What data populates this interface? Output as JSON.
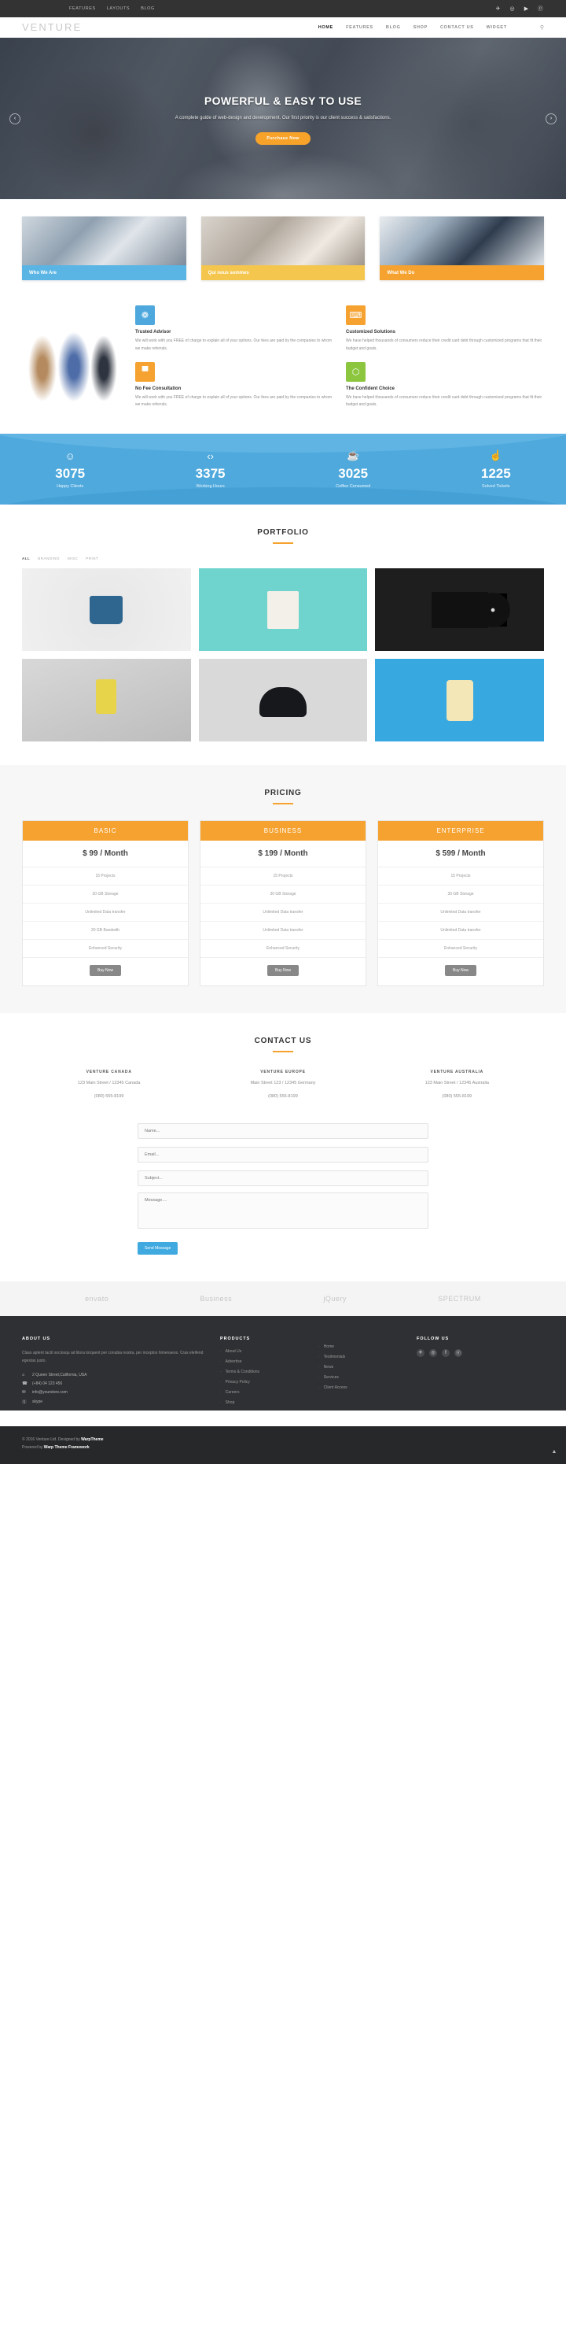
{
  "topbar": {
    "links": [
      "FEATURES",
      "LAYOUTS",
      "BLOG"
    ],
    "socials": [
      "twitter-icon",
      "instagram-icon",
      "youtube-icon",
      "pinterest-icon"
    ],
    "social_glyphs": [
      "✈",
      "◎",
      "▶",
      "ⓟ"
    ]
  },
  "nav": {
    "logo": "VENTURE",
    "items": [
      {
        "label": "HOME",
        "active": true,
        "caret": ""
      },
      {
        "label": "FEATURES",
        "active": false,
        "caret": ""
      },
      {
        "label": "BLOG",
        "active": false,
        "caret": "▾"
      },
      {
        "label": "SHOP",
        "active": false,
        "caret": ""
      },
      {
        "label": "CONTACT US",
        "active": false,
        "caret": ""
      },
      {
        "label": "WIDGET",
        "active": false,
        "caret": ""
      }
    ],
    "search_icon": "⚲"
  },
  "hero": {
    "title": "POWERFUL & EASY TO USE",
    "subtitle": "A complete guide of web-design and development. Our first priority is our client success & satisfactions.",
    "button": "Purchase Now",
    "prev": "‹",
    "next": "›"
  },
  "cards": [
    {
      "caption": "Who We Are",
      "color": "#5ab4e4"
    },
    {
      "caption": "Qui nous sommes",
      "color": "#f4c64e"
    },
    {
      "caption": "What We Do",
      "color": "#f5a230"
    }
  ],
  "features": [
    {
      "icon": "target-icon",
      "glyph": "❁",
      "color": "blue",
      "title": "Trusted Advisor",
      "text": "We will work with you FREE of charge to explain all of your options. Our fees are paid by the companies to whom we make referrals."
    },
    {
      "icon": "chat-icon",
      "glyph": "⌨",
      "color": "orange",
      "title": "Customized Solutions",
      "text": "We have helped thousands of consumers reduce their credit card debt through customized programs that fit their budget and goals."
    },
    {
      "icon": "chart-icon",
      "glyph": "▀",
      "color": "orange2",
      "title": "No Fee Consultation",
      "text": "We will work with you FREE of charge to explain all of your options. Our fees are paid by the companies to whom we make referrals."
    },
    {
      "icon": "shield-icon",
      "glyph": "⬡",
      "color": "green",
      "title": "The Confident Choice",
      "text": "We have helped thousands of consumers reduce their credit card debt through customized programs that fit their budget and goals."
    }
  ],
  "counters": [
    {
      "icon": "smiley-icon",
      "glyph": "☺",
      "value": "3075",
      "label": "Happy Clients"
    },
    {
      "icon": "code-icon",
      "glyph": "‹›",
      "value": "3375",
      "label": "Working Hours"
    },
    {
      "icon": "coffee-icon",
      "glyph": "☕",
      "value": "3025",
      "label": "Coffee Consumed"
    },
    {
      "icon": "thumbs-up-icon",
      "glyph": "☝",
      "value": "1225",
      "label": "Solved Tickets"
    }
  ],
  "portfolio": {
    "title": "PORTFOLIO",
    "filters": [
      {
        "label": "ALL",
        "active": true
      },
      {
        "label": "BRANDING",
        "active": false
      },
      {
        "label": "MISC",
        "active": false
      },
      {
        "label": "PRINT",
        "active": false
      }
    ],
    "items": [
      {
        "name": "enamel-mug"
      },
      {
        "name": "tote-bag"
      },
      {
        "name": "vinyl-record"
      },
      {
        "name": "coffee-cup"
      },
      {
        "name": "snapback-cap"
      },
      {
        "name": "plastic-pouch"
      }
    ]
  },
  "pricing": {
    "title": "PRICING",
    "plans": [
      {
        "name": "BASIC",
        "price": "$ 99 / Month",
        "features": [
          "15 Projects",
          "30 GB Storage",
          "Unlimited Data transfer",
          "30 GB Bandwith",
          "Enhanced Security"
        ],
        "button": "Buy Now"
      },
      {
        "name": "BUSINESS",
        "price": "$ 199 / Month",
        "features": [
          "15 Projects",
          "30 GB Storage",
          "Unlimited Data transfer",
          "Unlimited Data transfer",
          "Enhanced Security"
        ],
        "button": "Buy Now"
      },
      {
        "name": "ENTERPRISE",
        "price": "$ 599 / Month",
        "features": [
          "15 Projects",
          "30 GB Storage",
          "Unlimited Data transfer",
          "Unlimited Data transfer",
          "Enhanced Security"
        ],
        "button": "Buy Now"
      }
    ]
  },
  "contact": {
    "title": "CONTACT US",
    "offices": [
      {
        "name": "VENTURE CANADA",
        "address": "123 Main Street / 12345 Canada",
        "phone": "(080) 555-8199"
      },
      {
        "name": "VENTURE EUROPE",
        "address": "Main Street 123 / 12345 Germany",
        "phone": "(080) 555-8199"
      },
      {
        "name": "VENTURE AUSTRALIA",
        "address": "123 Main Street / 12345 Australia",
        "phone": "(080) 555-8199"
      }
    ],
    "form": {
      "name_placeholder": "Name...",
      "email_placeholder": "Email...",
      "subject_placeholder": "Subject...",
      "message_placeholder": "Message....",
      "submit": "Send Message"
    }
  },
  "brands": [
    "envato",
    "Business",
    "jQuery",
    "SPECTRUM"
  ],
  "footer": {
    "about": {
      "title": "ABOUT US",
      "text": "Class aptent taciti sociosqu ad litora torquent per conubia nostra, per inceptos himenaeos. Cras eleifend egestas justo.",
      "contacts": [
        {
          "icon": "home-icon",
          "glyph": "⌂",
          "text": "2 Queen Street,California, USA"
        },
        {
          "icon": "phone-icon",
          "glyph": "☎",
          "text": "(+84) 04 123 456"
        },
        {
          "icon": "mail-icon",
          "glyph": "✉",
          "text": "info@yourstore.com"
        },
        {
          "icon": "skype-icon",
          "glyph": "Ⓢ",
          "text": "skype"
        }
      ]
    },
    "products": {
      "title": "PRODUCTS",
      "links": [
        "About Us",
        "Advertise",
        "Terms & Conditions",
        "Privacy Policy",
        "Careers",
        "Shop"
      ]
    },
    "support": {
      "title": "",
      "links": [
        "Home",
        "Testimonials",
        "News",
        "Services",
        "Client Access"
      ]
    },
    "follow": {
      "title": "FOLLOW US",
      "socials": [
        {
          "icon": "twitter-icon",
          "glyph": "✈"
        },
        {
          "icon": "instagram-icon",
          "glyph": "◎"
        },
        {
          "icon": "facebook-icon",
          "glyph": "f"
        },
        {
          "icon": "pinterest-icon",
          "glyph": "ⓟ"
        }
      ]
    },
    "copyright_line1_prefix": "© 2016 Venture Ltd. Designed by ",
    "copyright_line1_strong": "WarpTheme",
    "copyright_line2_prefix": "Powered by ",
    "copyright_line2_strong": "Warp Theme Framework",
    "to_top": "▲"
  }
}
